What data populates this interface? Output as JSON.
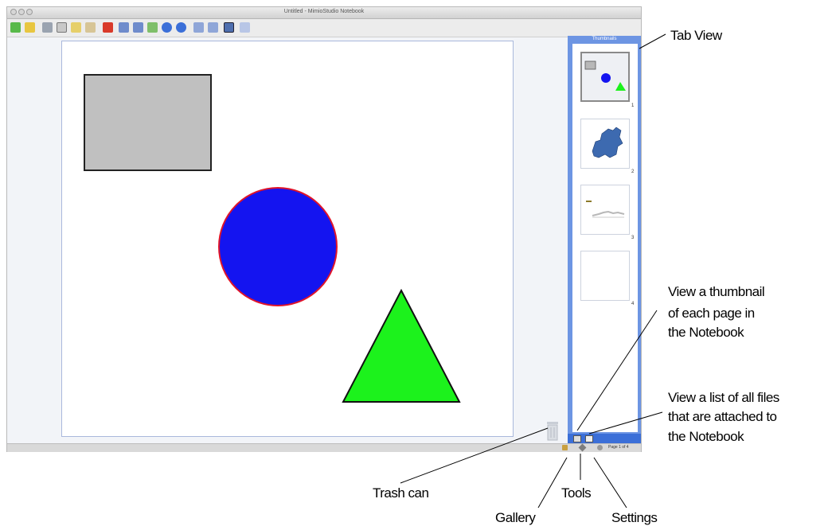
{
  "window": {
    "title": "Untitled - MimioStudio Notebook"
  },
  "side_panel": {
    "header": "Thumbnails",
    "thumbnails": [
      {
        "number": "1"
      },
      {
        "number": "2"
      },
      {
        "number": "3"
      },
      {
        "number": "4"
      }
    ],
    "page_indicator": "Page 1 of 4"
  },
  "callouts": {
    "tab_view": "Tab View",
    "thumbnail_line1": "View a thumbnail",
    "thumbnail_line2": "of each page in",
    "thumbnail_line3": "the Notebook",
    "files_line1": "View a list of all files",
    "files_line2": "that are attached to",
    "files_line3": "the Notebook",
    "trash_can": "Trash can",
    "gallery": "Gallery",
    "tools": "Tools",
    "settings": "Settings"
  },
  "colors": {
    "rectangle_fill": "#c0c0c0",
    "circle_fill": "#1414f0",
    "circle_stroke": "#e0142a",
    "triangle_fill": "#1cf21c",
    "panel_blue": "#6d95e3"
  },
  "toolbar_icons": [
    "open-icon",
    "save-icon",
    "print-icon",
    "cut-icon",
    "copy-icon",
    "paste-icon",
    "delete-icon",
    "undo-icon",
    "redo-icon",
    "insert-icon",
    "zoom-in-icon",
    "zoom-out-icon",
    "rotate-left-icon",
    "rotate-right-icon",
    "fit-icon",
    "select-icon"
  ]
}
